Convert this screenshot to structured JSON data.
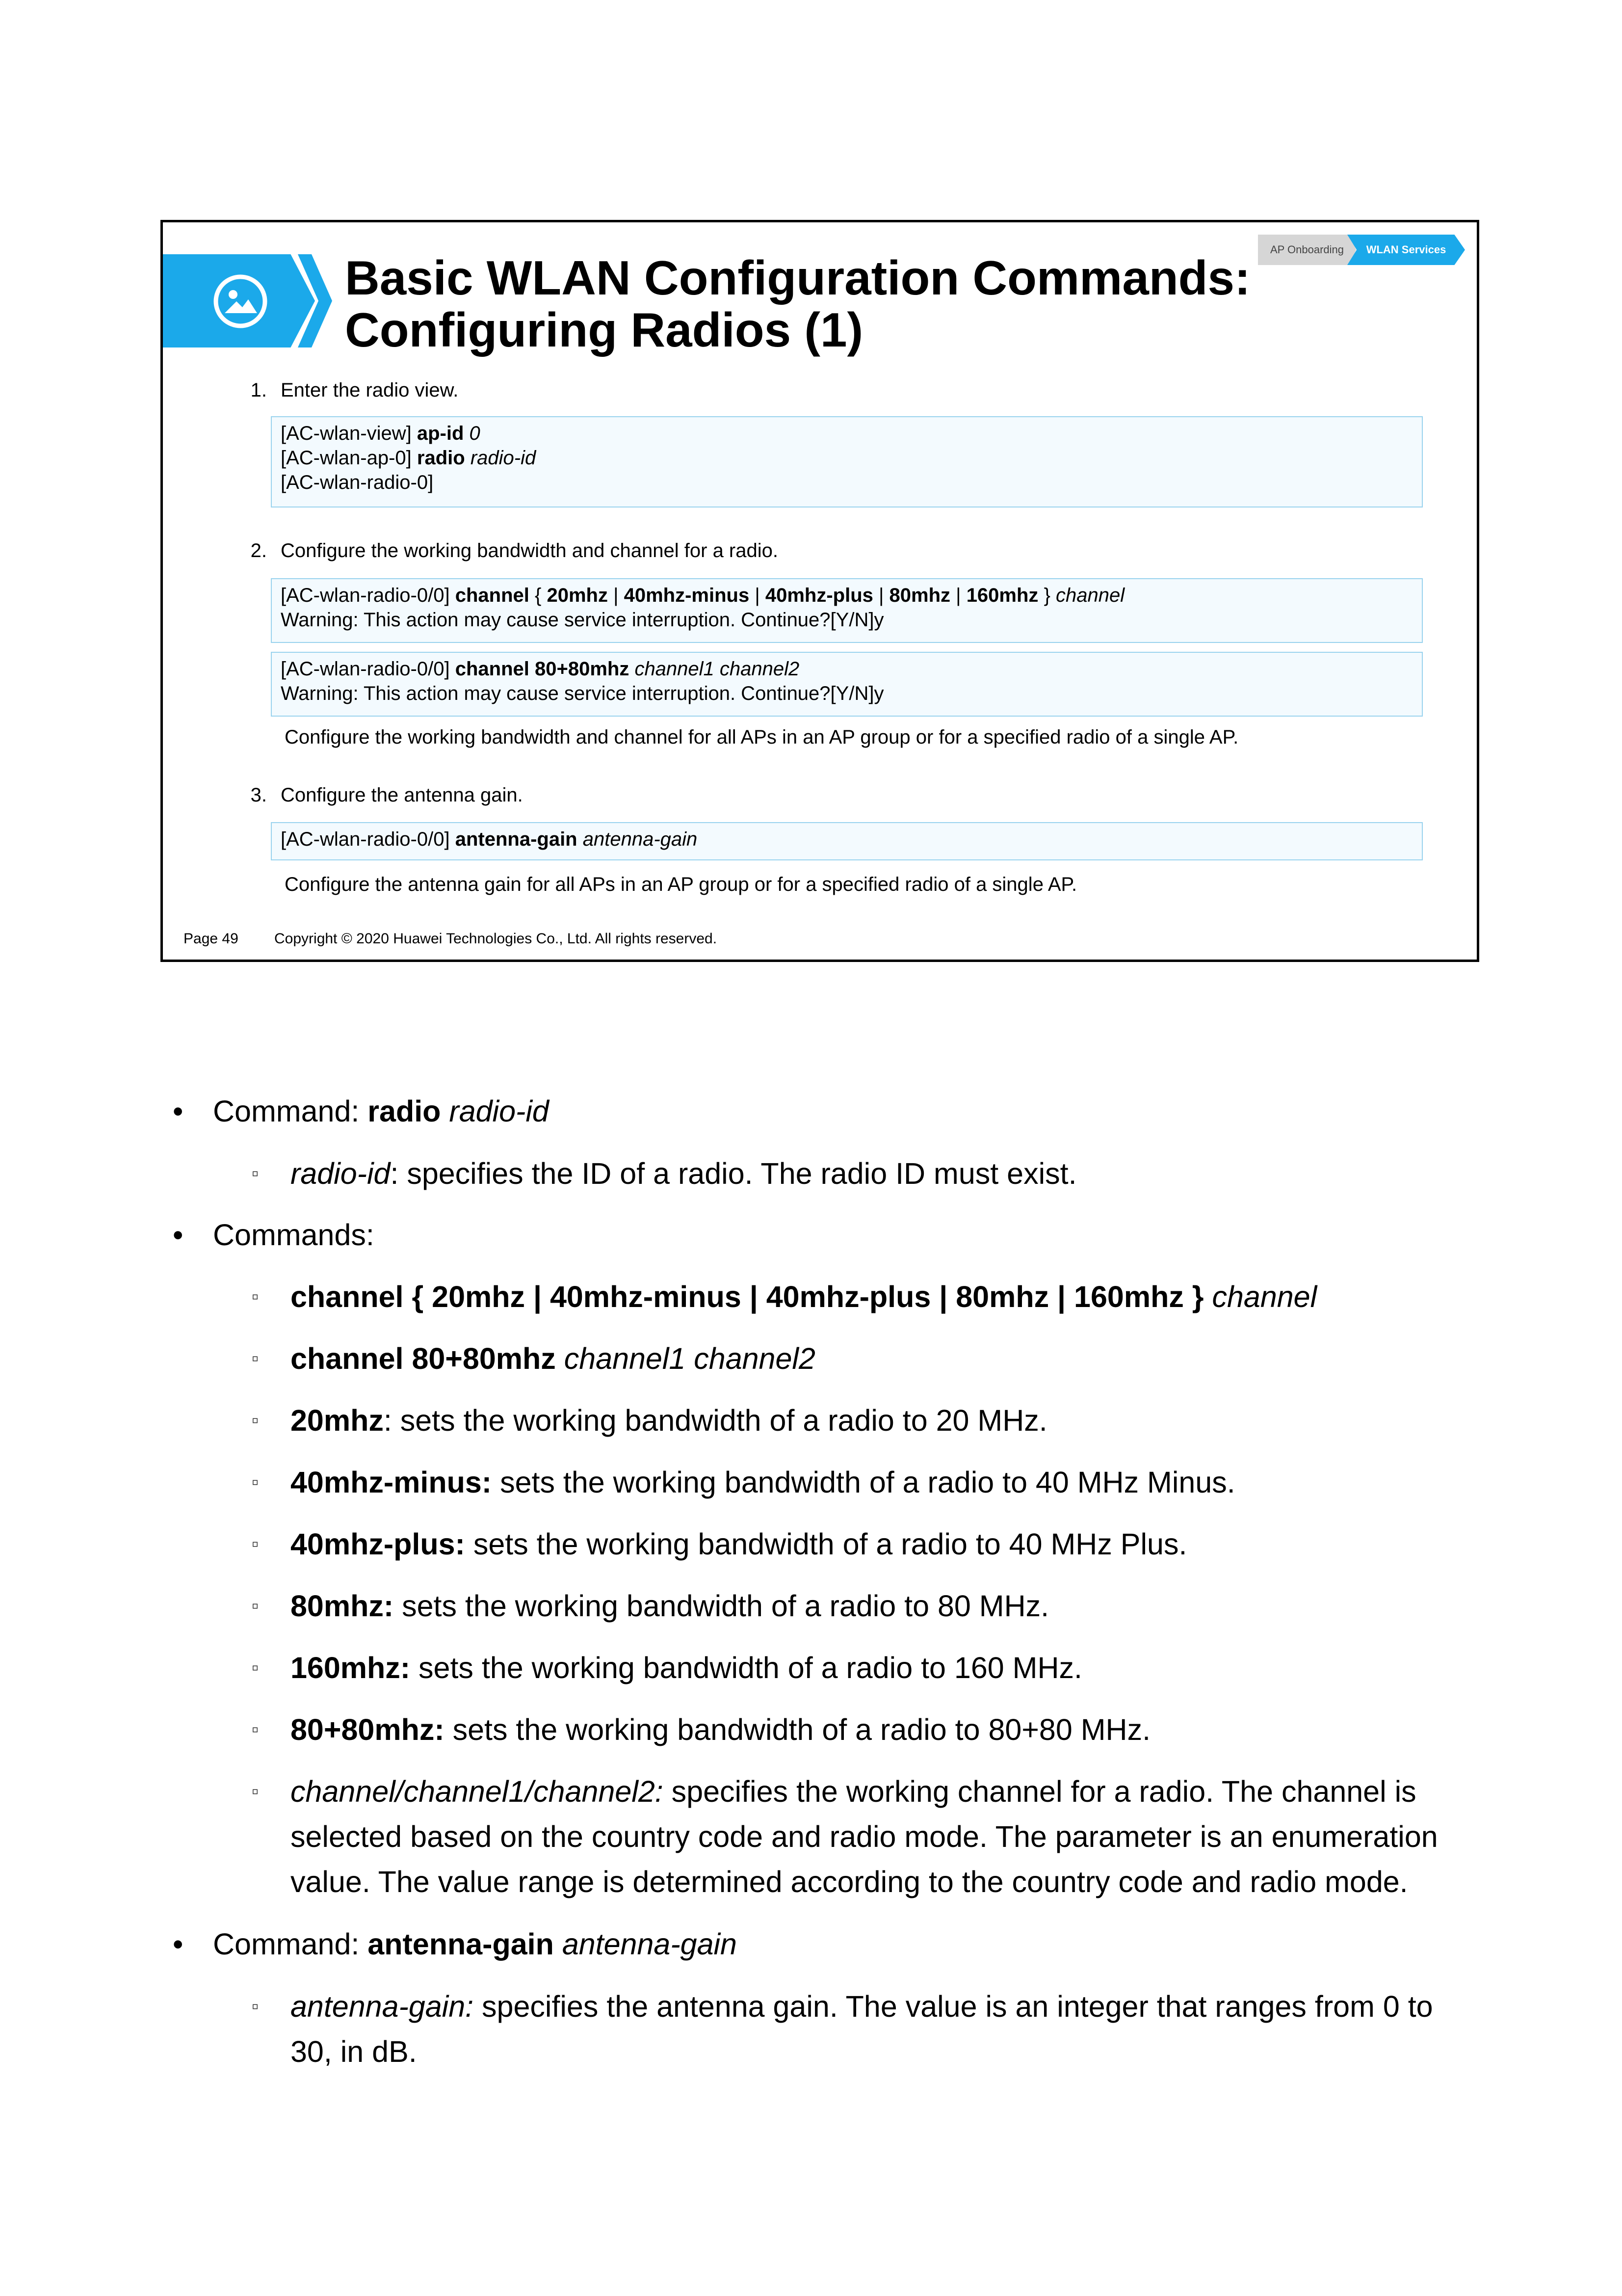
{
  "slide": {
    "title_line1": "Basic WLAN Configuration Commands:",
    "title_line2": "Configuring Radios (1)",
    "nav": {
      "inactive": "AP Onboarding",
      "active": "WLAN Services"
    },
    "banner_icon": "image-icon",
    "step1": {
      "num": "1.",
      "label": "Enter the radio view."
    },
    "box1": {
      "l1_prompt": "[AC-wlan-view]",
      "l1_cmd": "ap-id",
      "l1_arg": "0",
      "l2_prompt": "[AC-wlan-ap-0]",
      "l2_cmd": "radio",
      "l2_arg": "radio-id",
      "l3_prompt": "[AC-wlan-radio-0]"
    },
    "step2": {
      "num": "2.",
      "label": "Configure the working bandwidth and channel for a radio."
    },
    "box2": {
      "prompt": "[AC-wlan-radio-0/0]",
      "cmd": "channel",
      "brace_open": "{",
      "opt1": "20mhz",
      "opt2": "40mhz-minus",
      "opt3": "40mhz-plus",
      "opt4": "80mhz",
      "opt5": "160mhz",
      "sep": "|",
      "brace_close": "}",
      "arg": "channel",
      "warning": "Warning: This action may cause service interruption. Continue?[Y/N]y"
    },
    "box3": {
      "prompt": "[AC-wlan-radio-0/0]",
      "cmd": "channel 80+80mhz",
      "arg": "channel1 channel2",
      "warning": "Warning: This action may cause service interruption. Continue?[Y/N]y"
    },
    "note2": "Configure the working bandwidth and channel for all APs in an AP group or for a specified radio of a single AP.",
    "step3": {
      "num": "3.",
      "label": "Configure the antenna gain."
    },
    "box4": {
      "prompt": "[AC-wlan-radio-0/0]",
      "cmd": "antenna-gain",
      "arg": "antenna-gain"
    },
    "note3": "Configure the antenna gain for all APs in an AP group or for a specified radio of a single AP.",
    "footer": {
      "page": "Page 49",
      "copyright": "Copyright © 2020 Huawei Technologies Co., Ltd. All rights reserved."
    }
  },
  "body": {
    "bullet": "•",
    "sub_bullet": "▫",
    "b1": {
      "label": "Command: ",
      "cmd": "radio",
      "arg": "radio-id"
    },
    "b1a": {
      "arg": "radio-id",
      "desc": ": specifies the ID of a radio. The radio ID must exist."
    },
    "b2": {
      "label": "Commands:"
    },
    "b2a": {
      "cmd": "channel { 20mhz | 40mhz-minus | 40mhz-plus | 80mhz | 160mhz }",
      "arg": "channel"
    },
    "b2b": {
      "cmd": "channel 80+80mhz",
      "arg": "channel1 channel2"
    },
    "b2c": {
      "term": "20mhz",
      "desc": ": sets the working bandwidth of a radio to 20 MHz."
    },
    "b2d": {
      "term": "40mhz-minus:",
      "desc": " sets the working bandwidth of a radio to 40 MHz Minus."
    },
    "b2e": {
      "term": "40mhz-plus:",
      "desc": " sets the working bandwidth of a radio to 40 MHz Plus."
    },
    "b2f": {
      "term": "80mhz:",
      "desc": " sets the working bandwidth of a radio to 80 MHz."
    },
    "b2g": {
      "term": "160mhz:",
      "desc": " sets the working bandwidth of a radio to 160 MHz."
    },
    "b2h": {
      "term": "80+80mhz:",
      "desc": " sets the working bandwidth of a radio to 80+80 MHz."
    },
    "b2i": {
      "term": "channel/channel1/channel2:",
      "desc": " specifies the working channel for a radio. The channel is selected based on the country code and radio mode. The parameter is an enumeration value. The value range is determined according to the country code and radio mode."
    },
    "b3": {
      "label": "Command: ",
      "cmd": "antenna-gain",
      "arg": "antenna-gain"
    },
    "b3a": {
      "term": "antenna-gain:",
      "desc": " specifies the antenna gain. The value is an integer that ranges from 0 to 30, in dB."
    }
  }
}
